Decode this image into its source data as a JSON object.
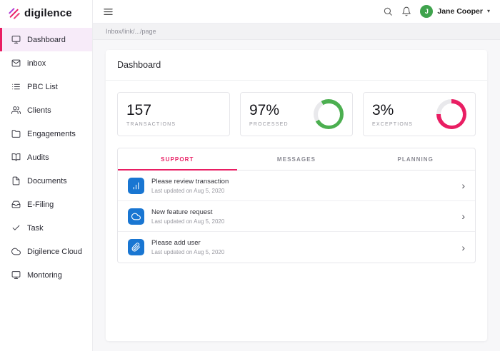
{
  "brand": {
    "name": "digilence"
  },
  "sidebar": {
    "items": [
      {
        "label": "Dashboard",
        "icon": "dashboard-icon",
        "active": true
      },
      {
        "label": "inbox",
        "icon": "mail-icon",
        "active": false
      },
      {
        "label": "PBC List",
        "icon": "list-icon",
        "active": false
      },
      {
        "label": "Clients",
        "icon": "users-icon",
        "active": false
      },
      {
        "label": "Engagements",
        "icon": "folder-icon",
        "active": false
      },
      {
        "label": "Audits",
        "icon": "book-icon",
        "active": false
      },
      {
        "label": "Documents",
        "icon": "document-icon",
        "active": false
      },
      {
        "label": "E-Filing",
        "icon": "inbox-tray-icon",
        "active": false
      },
      {
        "label": "Task",
        "icon": "check-icon",
        "active": false
      },
      {
        "label": "Digilence Cloud",
        "icon": "cloud-icon",
        "active": false
      },
      {
        "label": "Montoring",
        "icon": "monitor-icon",
        "active": false
      }
    ]
  },
  "topbar": {
    "user": {
      "name": "Jane Cooper",
      "avatar_initial": "J",
      "avatar_color": "#3fa34d"
    }
  },
  "breadcrumb": {
    "text": "Inbox/link/.../page"
  },
  "page": {
    "title": "Dashboard"
  },
  "stats": [
    {
      "value": "157",
      "label": "TRANSACTIONS"
    },
    {
      "value": "97%",
      "label": "PROCESSED",
      "ring": {
        "percent": 75,
        "color": "#4caf50",
        "start_deg": 330
      }
    },
    {
      "value": "3%",
      "label": "EXCEPTIONS",
      "ring": {
        "percent": 75,
        "color": "#e91e63",
        "start_deg": 0
      }
    }
  ],
  "tabs": [
    {
      "label": "SUPPORT",
      "active": true
    },
    {
      "label": "MESSAGES",
      "active": false
    },
    {
      "label": "PLANNING",
      "active": false
    }
  ],
  "messages": [
    {
      "icon": "bar-chart-icon",
      "title": "Please review transaction",
      "subtitle": "Last updated on Aug 5, 2020"
    },
    {
      "icon": "cloud-upload-icon",
      "title": "New feature request",
      "subtitle": "Last updated on Aug 5, 2020"
    },
    {
      "icon": "attachment-icon",
      "title": "Please add user",
      "subtitle": "Last updated on Aug 5, 2020"
    }
  ],
  "colors": {
    "accent": "#e91e63",
    "active_item_bg": "#f7ebf9",
    "ring_green": "#4caf50",
    "ring_pink": "#e91e63",
    "icon_blue": "#1976d2",
    "avatar_green": "#3fa34d"
  }
}
